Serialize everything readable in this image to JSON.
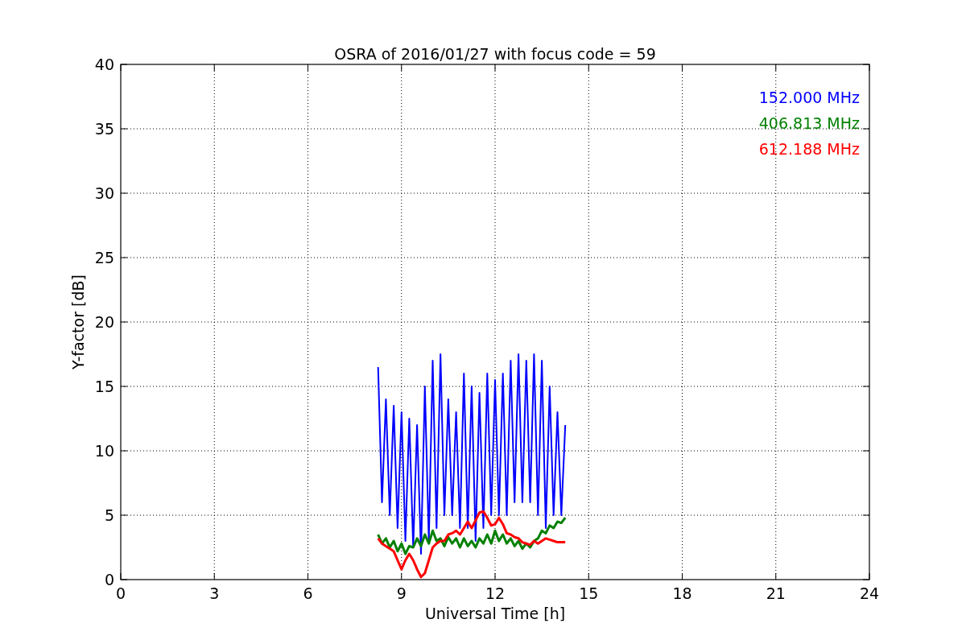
{
  "chart_data": {
    "type": "line",
    "title": "OSRA of 2016/01/27 with focus code = 59",
    "xlabel": "Universal Time [h]",
    "ylabel": "Y-factor [dB]",
    "xlim": [
      0,
      24
    ],
    "ylim": [
      0,
      40
    ],
    "grid": true,
    "xticks": [
      0,
      3,
      6,
      9,
      12,
      15,
      18,
      21,
      24
    ],
    "yticks": [
      0,
      5,
      10,
      15,
      20,
      25,
      30,
      35,
      40
    ],
    "x": [
      8.25,
      8.375,
      8.5,
      8.625,
      8.75,
      8.875,
      9,
      9.125,
      9.25,
      9.375,
      9.5,
      9.625,
      9.75,
      9.875,
      10,
      10.125,
      10.25,
      10.375,
      10.5,
      10.625,
      10.75,
      10.875,
      11,
      11.125,
      11.25,
      11.375,
      11.5,
      11.625,
      11.75,
      11.875,
      12,
      12.125,
      12.25,
      12.375,
      12.5,
      12.625,
      12.75,
      12.875,
      13,
      13.125,
      13.25,
      13.375,
      13.5,
      13.625,
      13.75,
      13.875,
      14,
      14.125,
      14.25
    ],
    "series": [
      {
        "name": "152.000 MHz",
        "color": "#0000ff",
        "values": [
          16.5,
          6,
          14,
          5,
          13.5,
          4,
          13,
          3,
          12.5,
          2.5,
          12,
          2,
          15,
          3,
          17,
          4,
          17.5,
          5,
          14,
          5,
          13,
          4,
          16,
          4,
          15,
          3,
          14.5,
          4,
          16,
          5,
          15.5,
          5,
          16,
          5,
          17,
          6,
          17.5,
          6,
          17,
          6,
          17.5,
          5,
          17,
          4,
          15,
          5,
          13,
          5,
          12
        ]
      },
      {
        "name": "406.813 MHz",
        "color": "#008000",
        "values": [
          3.5,
          2.8,
          3.2,
          2.5,
          3,
          2.2,
          2.8,
          2,
          2.6,
          2.5,
          3.2,
          2.6,
          3.5,
          2.8,
          3.8,
          3,
          3.2,
          2.6,
          3.3,
          2.8,
          3.2,
          2.5,
          3.2,
          2.6,
          3,
          2.5,
          3.2,
          2.8,
          3.5,
          2.8,
          3.8,
          3,
          3.5,
          2.8,
          3.2,
          2.6,
          3,
          2.4,
          2.8,
          2.5,
          3,
          3.2,
          3.8,
          3.6,
          4.2,
          4,
          4.5,
          4.4,
          4.8
        ]
      },
      {
        "name": "612.188 MHz",
        "color": "#ff0000",
        "values": [
          3.2,
          2.8,
          2.6,
          2.4,
          2.2,
          1.5,
          0.8,
          1.5,
          2,
          1.5,
          0.8,
          0.2,
          0.5,
          1.5,
          2.5,
          2.8,
          3,
          3,
          3.5,
          3.6,
          3.8,
          3.5,
          4,
          4.5,
          4,
          4.6,
          5.2,
          5.3,
          4.8,
          4.2,
          4.3,
          4.8,
          4.3,
          3.6,
          3.5,
          3.3,
          3.2,
          2.9,
          2.8,
          2.7,
          3,
          2.8,
          3,
          3.2,
          3.1,
          3,
          2.9,
          2.9,
          2.9
        ]
      }
    ]
  }
}
